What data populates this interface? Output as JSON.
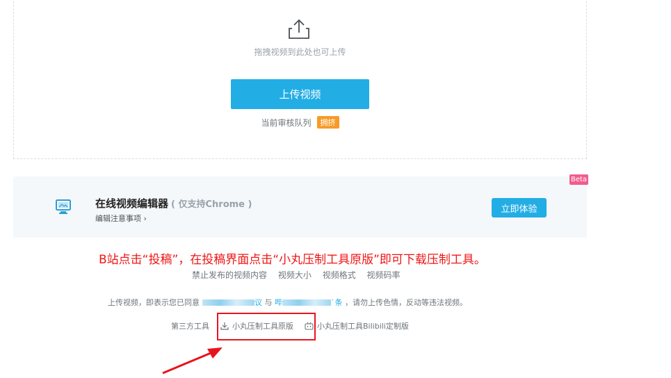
{
  "upload": {
    "drag_hint": "拖拽视频到此处也可上传",
    "upload_button": "上传视频",
    "queue_label": "当前审核队列",
    "queue_status": "拥挤"
  },
  "editor": {
    "beta": "Beta",
    "title": "在线视频编辑器",
    "subtitle": "( 仅支持Chrome )",
    "notes": "编辑注意事项 ›",
    "try_button": "立即体验"
  },
  "annotation": {
    "text": "B站点击“投稿”，在投稿界面点击“小丸压制工具原版”即可下载压制工具。",
    "color": "#f01414"
  },
  "tags": [
    "禁止发布的视频内容",
    "视频大小",
    "视频格式",
    "视频码率"
  ],
  "agreement": {
    "prefix": "上传视频，即表示您已同意",
    "mid_tail": "议",
    "connector": "与",
    "link2_head": "哔",
    "link2_tail": "`条",
    "suffix": "，请勿上传色情，反动等违法视频。"
  },
  "tools": {
    "label": "第三方工具",
    "items": [
      "小丸压制工具原版",
      "小丸压制工具Bilibili定制版"
    ]
  },
  "colors": {
    "accent": "#23ade5",
    "badge": "#f79b28",
    "beta": "#f25d8e",
    "highlight": "#e8141c"
  }
}
